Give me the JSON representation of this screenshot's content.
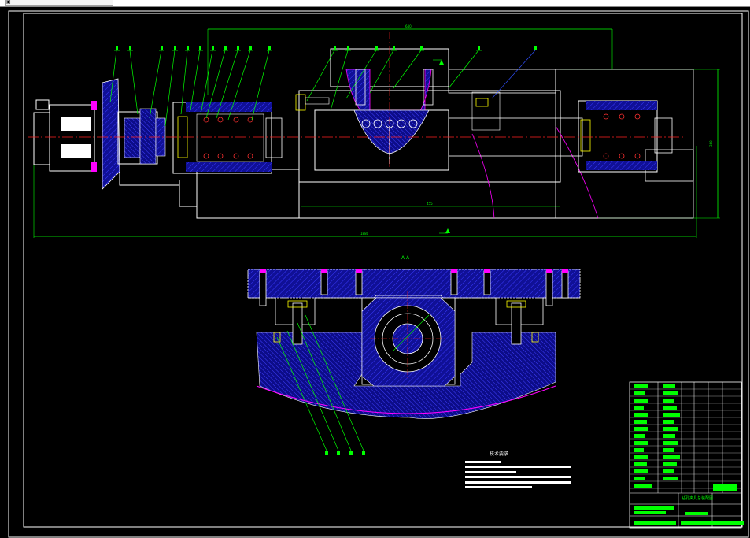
{
  "app": {
    "tab_title": "",
    "tab_icon": "drawing-file-icon"
  },
  "drawing": {
    "section_label": "A-A",
    "top_dimension": "640",
    "overall_length": "1880",
    "right_height": "360",
    "center_length": "455",
    "notes_title": "技术要求",
    "balloon_count_top": 17,
    "balloon_count_bottom": 4
  },
  "title_block": {
    "drawing_name": "钻孔夹具总装配图",
    "school": "",
    "scale": ""
  },
  "colors": {
    "background": "#000000",
    "frame": "#ffffff",
    "outline": "#ffffff",
    "dimension": "#00ff00",
    "leader": "#00ff00",
    "hatch": "#1e1ec8",
    "fill_dark": "#1010a0",
    "center_line": "#ff2020",
    "magenta": "#ff00ff",
    "cyan": "#00ffff",
    "yellow": "#ffff00",
    "title_text": "#00ff00"
  }
}
